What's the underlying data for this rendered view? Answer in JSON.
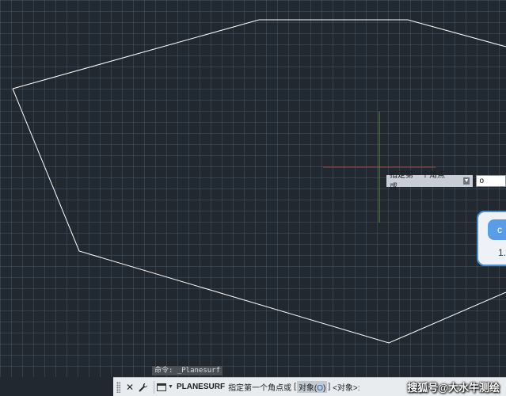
{
  "tooltip": {
    "prompt": "指定第一个角点或",
    "arrow_icon": "down-arrow-icon",
    "input_value": "o"
  },
  "side_panel": {
    "button_text": "c",
    "text": "1."
  },
  "command_history": {
    "line": "命令: _Planesurf"
  },
  "command_line": {
    "close_icon": "close-icon",
    "customize_icon": "wrench-icon",
    "command": "PLANESURF",
    "prompt": "指定第一个角点或",
    "bracket_open": "[",
    "option_label": "对象(",
    "option_key": "O",
    "option_close": ")",
    "bracket_close": "]",
    "default": "<对象>:"
  },
  "watermark": "搜狐号@大水牛测绘",
  "colors": {
    "background": "#212830",
    "grid": "#46525f",
    "polygon": "#ffffff",
    "crosshair_horizontal": "#a0463c",
    "crosshair_vertical": "#5a8c3c"
  }
}
